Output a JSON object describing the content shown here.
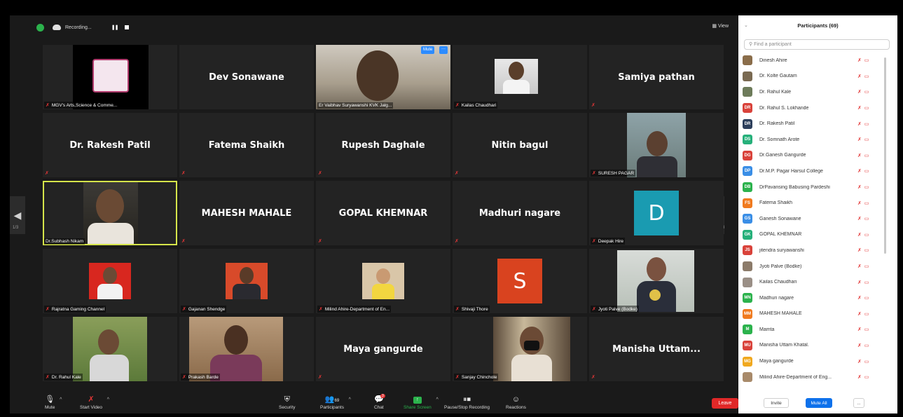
{
  "topbar": {
    "recording_label": "Recording...",
    "view_label": "View"
  },
  "tiles": [
    {
      "name": "MGV's Arts,Science & Comme...",
      "type": "logo"
    },
    {
      "name": "Dev Sonawane",
      "type": "name"
    },
    {
      "name": "Er Vaibhav Suryawanshi KVK Jalg...",
      "type": "video",
      "badge": "Mute"
    },
    {
      "name": "Kailas Chaudhari",
      "type": "photo"
    },
    {
      "name": "Samiya pathan",
      "type": "name"
    },
    {
      "name": "Dr. Rakesh Patil",
      "type": "name"
    },
    {
      "name": "Fatema Shaikh",
      "type": "name"
    },
    {
      "name": "Rupesh Daghale",
      "type": "name"
    },
    {
      "name": "Nitin bagul",
      "type": "name"
    },
    {
      "name": "SURESH PAGAR",
      "type": "video"
    },
    {
      "name": "Dr.Subhash Nikam",
      "type": "video"
    },
    {
      "name": "MAHESH MAHALE",
      "type": "name"
    },
    {
      "name": "GOPAL KHEMNAR",
      "type": "name"
    },
    {
      "name": "Madhuri nagare",
      "type": "name"
    },
    {
      "name": "Deepak Hire",
      "type": "letter",
      "letter": "D"
    },
    {
      "name": "Rajratna Gaming Channel",
      "type": "photo"
    },
    {
      "name": "Gajanan Shendge",
      "type": "photo"
    },
    {
      "name": "Milind Ahire-Department of En...",
      "type": "photo"
    },
    {
      "name": "Shivaji Thore",
      "type": "letter",
      "letter": "S"
    },
    {
      "name": "Jyoti Palve (Bodke)",
      "type": "photo"
    },
    {
      "name": "Dr. Rahul Kale",
      "type": "photo"
    },
    {
      "name": "Prakash Barde",
      "type": "photo"
    },
    {
      "name": "Maya gangurde",
      "type": "name"
    },
    {
      "name": "Sanjay Chinchole",
      "type": "video"
    },
    {
      "name": "Manisha  Uttam...",
      "type": "name"
    }
  ],
  "pager": {
    "left": "1/3",
    "right": "1/3"
  },
  "toolbar": {
    "mute": "Mute",
    "start_video": "Start Video",
    "security": "Security",
    "participants": "Participants",
    "participants_count": "69",
    "chat": "Chat",
    "chat_badge": "3",
    "share_screen": "Share Screen",
    "pause_stop_recording": "Pause/Stop Recording",
    "reactions": "Reactions",
    "leave": "Leave"
  },
  "panel": {
    "title": "Participants (69)",
    "search_placeholder": "Find a participant",
    "invite": "Invite",
    "mute_all": "Mute All",
    "more": "..."
  },
  "participants": [
    {
      "name": "Dinesh Ahire",
      "initials": "",
      "color": "#8a6d4a"
    },
    {
      "name": "Dr. Kolte Gautam",
      "initials": "",
      "color": "#7a6a52"
    },
    {
      "name": "Dr. Rahul Kale",
      "initials": "",
      "color": "#6d7b5a"
    },
    {
      "name": "Dr. Rahul S. Lokhande",
      "initials": "DR",
      "color": "#d9423a"
    },
    {
      "name": "Dr. Rakesh Patil",
      "initials": "DR",
      "color": "#2d3f5c"
    },
    {
      "name": "Dr. Somnath Arote",
      "initials": "DS",
      "color": "#26b07a"
    },
    {
      "name": "Dr.Ganesh Gangurde",
      "initials": "DG",
      "color": "#d9423a"
    },
    {
      "name": "Dr.M.P. Pagar Harsul College",
      "initials": "DP",
      "color": "#3a8ee6"
    },
    {
      "name": "DrPavansing Babusing Pardeshi",
      "initials": "DB",
      "color": "#2bb24c"
    },
    {
      "name": "Fatema Shaikh",
      "initials": "FS",
      "color": "#f07a1e"
    },
    {
      "name": "Ganesh Sonawane",
      "initials": "GS",
      "color": "#3a8ee6"
    },
    {
      "name": "GOPAL KHEMNAR",
      "initials": "GK",
      "color": "#26b07a"
    },
    {
      "name": "jitendra suryawanshi",
      "initials": "JS",
      "color": "#d9423a"
    },
    {
      "name": "Jyoti Palve (Bodke)",
      "initials": "",
      "color": "#8c7b6a"
    },
    {
      "name": "Kailas Chaudhari",
      "initials": "",
      "color": "#9a8f86"
    },
    {
      "name": "Madhuri nagare",
      "initials": "MN",
      "color": "#2bb24c"
    },
    {
      "name": "MAHESH MAHALE",
      "initials": "MM",
      "color": "#f07a1e"
    },
    {
      "name": "Mamta",
      "initials": "M",
      "color": "#2bb24c"
    },
    {
      "name": "Manisha Uttam Khatal.",
      "initials": "MU",
      "color": "#d9423a"
    },
    {
      "name": "Maya gangurde",
      "initials": "MG",
      "color": "#f0a81e"
    },
    {
      "name": "Milind Ahire-Department of Eng...",
      "initials": "",
      "color": "#a88a6a"
    }
  ]
}
